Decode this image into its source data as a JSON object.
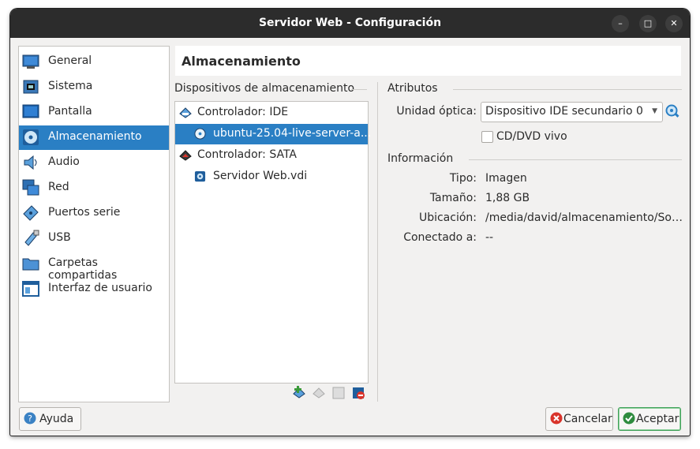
{
  "window": {
    "title": "Servidor Web - Configuración",
    "controls": {
      "minimize": "–",
      "maximize": "□",
      "close": "✕"
    }
  },
  "sidebar": {
    "items": [
      {
        "label": "General",
        "icon": "monitor-icon",
        "selected": false
      },
      {
        "label": "Sistema",
        "icon": "chip-icon",
        "selected": false
      },
      {
        "label": "Pantalla",
        "icon": "display-icon",
        "selected": false
      },
      {
        "label": "Almacenamiento",
        "icon": "disc-icon",
        "selected": true
      },
      {
        "label": "Audio",
        "icon": "speaker-icon",
        "selected": false
      },
      {
        "label": "Red",
        "icon": "network-icon",
        "selected": false
      },
      {
        "label": "Puertos serie",
        "icon": "serial-port-icon",
        "selected": false
      },
      {
        "label": "USB",
        "icon": "usb-icon",
        "selected": false
      },
      {
        "label": "Carpetas compartidas",
        "icon": "folder-icon",
        "selected": false
      },
      {
        "label": "Interfaz de usuario",
        "icon": "ui-window-icon",
        "selected": false
      }
    ]
  },
  "page": {
    "title": "Almacenamiento"
  },
  "storage": {
    "section_label": "Dispositivos de almacenamiento",
    "tree": [
      {
        "label": "Controlador: IDE",
        "type": "controller",
        "icon": "ide-controller-icon"
      },
      {
        "label": "ubuntu-25.04-live-server-a...",
        "type": "optical",
        "icon": "optical-disc-icon",
        "selected": true
      },
      {
        "label": "Controlador: SATA",
        "type": "controller",
        "icon": "sata-controller-icon"
      },
      {
        "label": "Servidor Web.vdi",
        "type": "disk",
        "icon": "hard-disk-icon"
      }
    ],
    "toolbar": [
      "add-controller-icon",
      "add-attachment-icon",
      "remove-attachment-icon",
      "remove-controller-icon"
    ]
  },
  "attributes": {
    "section_label": "Atributos",
    "optical_drive_label": "Unidad óptica:",
    "optical_drive_value": "Dispositivo IDE secundario 0",
    "live_cd_label": "CD/DVD vivo",
    "live_cd_checked": false
  },
  "info": {
    "section_label": "Información",
    "rows": [
      {
        "label": "Tipo:",
        "value": "Imagen"
      },
      {
        "label": "Tamaño:",
        "value": "1,88 GB"
      },
      {
        "label": "Ubicación:",
        "value": "/media/david/almacenamiento/Sof…"
      },
      {
        "label": "Conectado a:",
        "value": "--"
      }
    ]
  },
  "buttons": {
    "help": "Ayuda",
    "cancel": "Cancelar",
    "accept": "Aceptar"
  },
  "colors": {
    "selection": "#2a7fc4",
    "titlebar": "#2c2c2c",
    "accept_border": "#3fa058",
    "cancel_icon": "#d9342b"
  }
}
